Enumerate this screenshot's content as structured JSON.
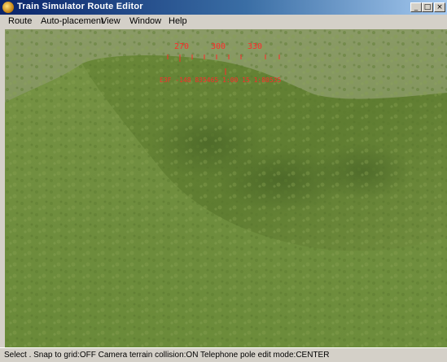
{
  "window": {
    "title": "Train Simulator Route Editor",
    "controls": {
      "minimize": "_",
      "maximize": "□",
      "close": "×"
    }
  },
  "menu": [
    "Route",
    "Auto-placement",
    "View",
    "Window",
    "Help"
  ],
  "compass": {
    "headings": [
      "270",
      "300",
      "330"
    ],
    "readout": "E3F  -148  835465  1:00  15  1:80535",
    "color": "#ff2a2a"
  },
  "status": {
    "text": "Select . Snap to grid:OFF Camera terrain collision:ON Telephone pole edit mode:CENTER"
  },
  "colors": {
    "titlebar_start": "#0a246a",
    "titlebar_end": "#a6caf0",
    "sky": "#7c8f55",
    "terrain": "#6f8c3c"
  }
}
